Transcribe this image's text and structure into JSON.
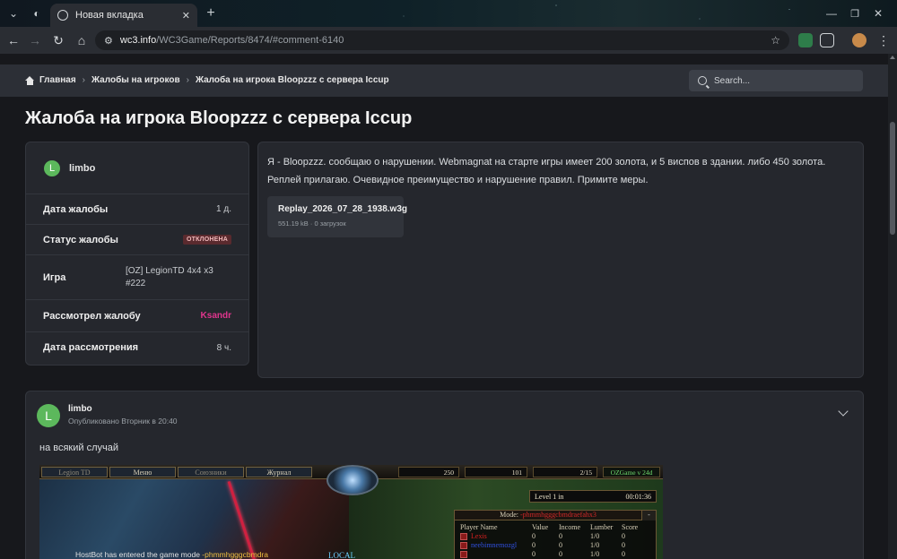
{
  "browser": {
    "tab_title": "Новая вкладка",
    "url_host": "wc3.info",
    "url_path": "/WC3Game/Reports/8474/#comment-6140"
  },
  "breadcrumb": {
    "home": "Главная",
    "section": "Жалобы на игроков",
    "current": "Жалоба на игрока Bloopzzz с сервера Iccup"
  },
  "search": {
    "placeholder": "Search..."
  },
  "page": {
    "title": "Жалоба на игрока Bloopzzz с сервера Iccup"
  },
  "report": {
    "author": "limbo",
    "author_initial": "L",
    "rows": {
      "date_label": "Дата жалобы",
      "date_value": "1 д.",
      "status_label": "Статус жалобы",
      "status_value": "ОТКЛОНЕНА",
      "game_label": "Игра",
      "game_value": "[OZ] LegionTD 4x4 x3 #222",
      "reviewer_label": "Рассмотрел жалобу",
      "reviewer_value": "Ksandr",
      "review_date_label": "Дата рассмотрения",
      "review_date_value": "8 ч."
    },
    "message": "Я - Bloopzzz. сообщаю о нарушении. Webmagnat на старте игры имеет 200 золота, и 5 виспов в здании. либо 450 золота. Реплей прилагаю. Очевидное преимущество и нарушение правил. Примите меры.",
    "attachment": {
      "filename": "Replay_2026_07_28_1938.w3g",
      "meta": "551.19 kB · 0 загрузок"
    }
  },
  "comment": {
    "author": "limbo",
    "author_initial": "L",
    "posted": "Опубликовано Вторник в 20:40",
    "text": "на всякий случай",
    "screenshot": {
      "menu_items": [
        "Legion TD",
        "Меню",
        "Союзники",
        "Журнал"
      ],
      "gold": "250",
      "lumber": "101",
      "food": "2/15",
      "version": "OZGame v 24d",
      "level": "Level 1 in",
      "timer": "00:01:36",
      "mode_label": "Mode:",
      "mode_value": "-phmmhgggcbmdraefahx3",
      "columns": [
        "Player Name",
        "Value",
        "Income",
        "Lumber",
        "Score"
      ],
      "players": [
        {
          "name": "Lexis",
          "value": "0",
          "income": "0",
          "lumber": "1/0",
          "score": "0",
          "color": "#d82020"
        },
        {
          "name": "neebimnemozgl",
          "value": "0",
          "income": "0",
          "lumber": "1/0",
          "score": "0",
          "color": "#3050e0"
        },
        {
          "name": "",
          "value": "0",
          "income": "0",
          "lumber": "1/0",
          "score": "0",
          "color": "#20c0a0"
        }
      ],
      "chat_prefix": "HostBot has entered the game mode ",
      "chat_mode": "-phmmhgggcbmdra",
      "local_label": "LOCAL"
    }
  },
  "colors": {
    "accent_pink": "#e0358d",
    "avatar_green": "#5cb85c",
    "status_rejected": "#5a2a2e"
  }
}
